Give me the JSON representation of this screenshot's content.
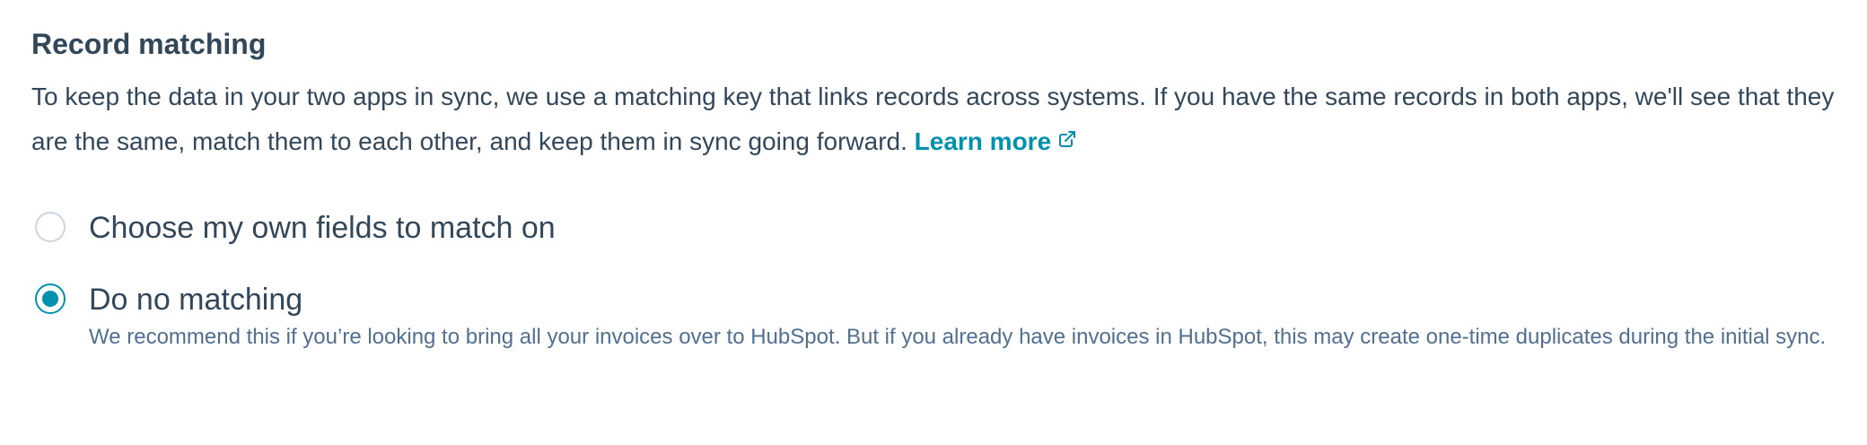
{
  "section": {
    "title": "Record matching",
    "description": "To keep the data in your two apps in sync, we use a matching key that links records across systems. If you have the same records in both apps, we'll see that they are the same, match them to each other, and keep them in sync going forward.",
    "learn_more_label": "Learn more",
    "learn_more_icon": "external-link-icon"
  },
  "options": [
    {
      "label": "Choose my own fields to match on",
      "selected": false
    },
    {
      "label": "Do no matching",
      "selected": true,
      "help": "We recommend this if you’re looking to bring all your invoices over to HubSpot. But if you already have invoices in HubSpot, this may create one-time duplicates during the initial sync."
    }
  ],
  "colors": {
    "text": "#33475b",
    "help_text": "#516f90",
    "accent": "#0091ae",
    "radio_border": "#cbd6e2"
  }
}
